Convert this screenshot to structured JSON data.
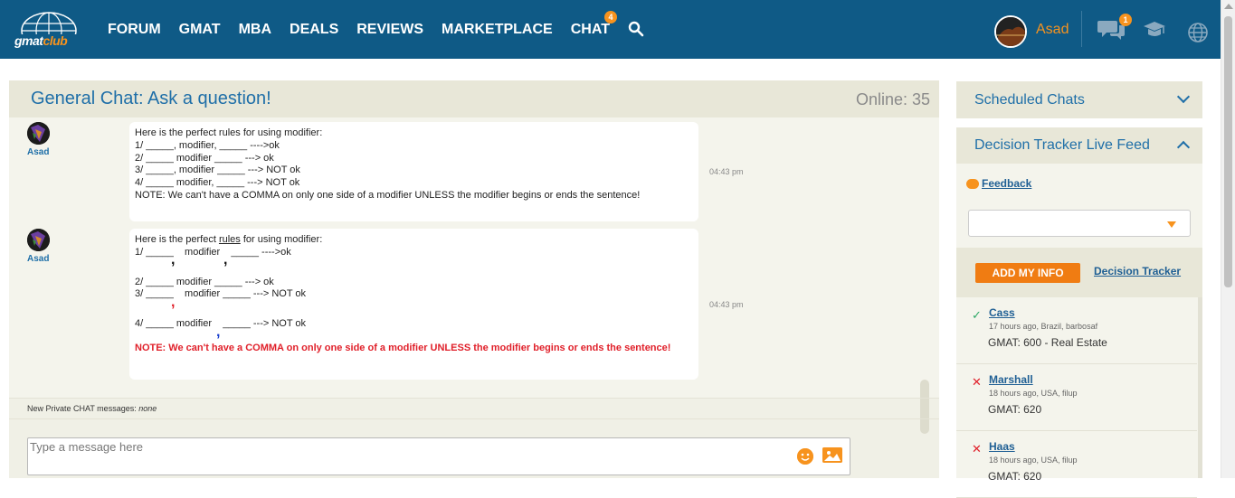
{
  "navbar": {
    "logo_text_1": "gmat",
    "logo_text_2": "club",
    "links": [
      {
        "label": "FORUM"
      },
      {
        "label": "GMAT"
      },
      {
        "label": "MBA"
      },
      {
        "label": "DEALS"
      },
      {
        "label": "REVIEWS"
      },
      {
        "label": "MARKETPLACE"
      },
      {
        "label": "CHAT",
        "badge": "4"
      }
    ],
    "user_name": "Asad",
    "messages_badge": "1",
    "icons": [
      "search-icon",
      "chat-bubbles-icon",
      "graduation-cap-icon",
      "globe-icon"
    ],
    "accent_color": "#f7931e",
    "bar_color": "#0f5a86"
  },
  "chat": {
    "title": "General Chat: Ask a question!",
    "online": "Online: 35",
    "messages": [
      {
        "author": "Asad",
        "time": "04:43 pm",
        "lines": [
          "Here is the perfect rules for using modifier:",
          "1/ _____, modifier, _____ ---->ok",
          "2/ _____ modifier _____ ---> ok",
          "3/ _____, modifier _____ ---> NOT ok",
          "4/ _____ modifier, _____ ---> NOT ok",
          "NOTE: We can't have a COMMA on only one side of a modifier UNLESS the modifier begins or ends the sentence!"
        ]
      },
      {
        "author": "Asad",
        "time": "04:43 pm",
        "lines": {
          "l1_a": "Here is the perfect ",
          "l1_u": "rules",
          "l1_b": " for using modifier:",
          "l2": "1/ _____    modifier    _____ ---->ok",
          "l3": "2/ _____ modifier _____ ---> ok",
          "l4": "3/ _____    modifier _____ ---> NOT ok",
          "l5": "4/ _____ modifier    _____ ---> NOT ok",
          "note": "NOTE: We can't have a COMMA on only one side of a modifier UNLESS the modifier begins or ends the sentence!"
        },
        "comma_glyph": ","
      }
    ],
    "private_label": "New Private CHAT messages:",
    "private_value": "none",
    "input_placeholder": "Type a message here",
    "emoji_icon": "smiley-icon",
    "image_icon": "image-icon"
  },
  "sidebar": {
    "scheduled_title": "Scheduled Chats",
    "tracker_title": "Decision Tracker Live Feed",
    "feedback_label": "Feedback",
    "add_info_label": "ADD MY INFO",
    "tracker_link": "Decision Tracker",
    "feed": [
      {
        "status": "✓",
        "status_kind": "admitted",
        "name": "Cass",
        "meta": "17 hours ago, Brazil, barbosaf",
        "score": "GMAT: 600 - Real Estate"
      },
      {
        "status": "✕",
        "status_kind": "rejected",
        "name": "Marshall",
        "meta": "18 hours ago, USA, filup",
        "score": "GMAT: 620"
      },
      {
        "status": "✕",
        "status_kind": "rejected",
        "name": "Haas",
        "meta": "18 hours ago, USA, filup",
        "score": "GMAT: 620"
      }
    ]
  }
}
